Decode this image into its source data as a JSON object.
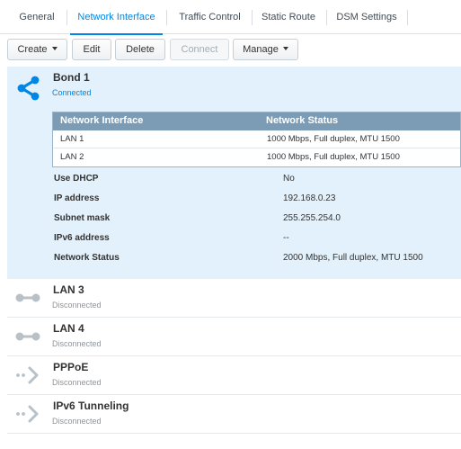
{
  "tabs": [
    {
      "label": "General"
    },
    {
      "label": "Network Interface"
    },
    {
      "label": "Traffic Control"
    },
    {
      "label": "Static Route"
    },
    {
      "label": "DSM Settings"
    }
  ],
  "active_tab": "Network Interface",
  "toolbar": {
    "create": "Create",
    "edit": "Edit",
    "delete": "Delete",
    "connect": "Connect",
    "manage": "Manage"
  },
  "bond": {
    "name": "Bond 1",
    "status": "Connected",
    "icon": "share-icon",
    "table": {
      "headers": [
        "Network Interface",
        "Network Status"
      ],
      "rows": [
        [
          "LAN 1",
          "1000 Mbps, Full duplex, MTU 1500"
        ],
        [
          "LAN 2",
          "1000 Mbps, Full duplex, MTU 1500"
        ]
      ]
    },
    "details": [
      {
        "label": "Use DHCP",
        "value": "No"
      },
      {
        "label": "IP address",
        "value": "192.168.0.23"
      },
      {
        "label": "Subnet mask",
        "value": "255.255.254.0"
      },
      {
        "label": "IPv6 address",
        "value": "--"
      },
      {
        "label": "Network Status",
        "value": "2000 Mbps, Full duplex, MTU 1500"
      }
    ]
  },
  "interfaces": [
    {
      "name": "LAN 3",
      "status": "Disconnected",
      "icon": "lan-icon"
    },
    {
      "name": "LAN 4",
      "status": "Disconnected",
      "icon": "lan-icon"
    },
    {
      "name": "PPPoE",
      "status": "Disconnected",
      "icon": "pppoe-icon"
    },
    {
      "name": "IPv6 Tunneling",
      "status": "Disconnected",
      "icon": "tunnel-icon"
    }
  ],
  "colors": {
    "accent": "#0086e5",
    "selected_bg": "#e2f1fb",
    "table_header": "#7c9cb6",
    "icon_disabled": "#b8c0c8"
  }
}
